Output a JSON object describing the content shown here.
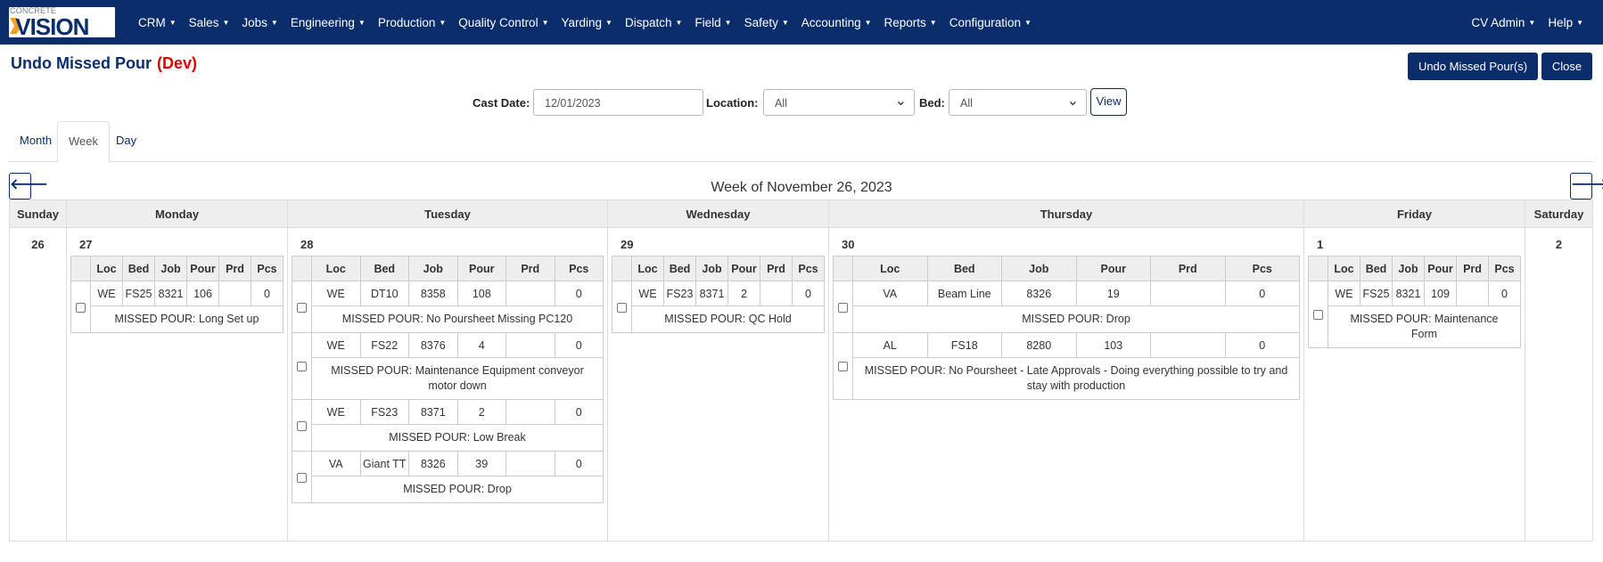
{
  "nav": {
    "logo_small": "CONCRETE",
    "logo_big": "VISION",
    "items": [
      "CRM",
      "Sales",
      "Jobs",
      "Engineering",
      "Production",
      "Quality Control",
      "Yarding",
      "Dispatch",
      "Field",
      "Safety",
      "Accounting",
      "Reports",
      "Configuration"
    ],
    "user": "CV Admin",
    "help": "Help"
  },
  "page": {
    "title": "Undo Missed Pour",
    "env": "(Dev)",
    "undo_button": "Undo Missed Pour(s)",
    "close_button": "Close"
  },
  "filters": {
    "cast_date_label": "Cast Date:",
    "cast_date_value": "12/01/2023",
    "location_label": "Location:",
    "location_value": "All",
    "bed_label": "Bed:",
    "bed_value": "All",
    "view_button": "View"
  },
  "tabs": [
    "Month",
    "Week",
    "Day"
  ],
  "active_tab": "Week",
  "week": {
    "title": "Week of November 26, 2023",
    "prev_icon": "arrow-left-icon",
    "next_icon": "arrow-right-icon"
  },
  "columns": [
    "Loc",
    "Bed",
    "Job",
    "Pour",
    "Prd",
    "Pcs"
  ],
  "days": [
    {
      "name": "Sunday",
      "num": "26",
      "pours": []
    },
    {
      "name": "Monday",
      "num": "27",
      "pours": [
        {
          "loc": "WE",
          "bed": "FS25",
          "job": "8321",
          "pour": "106",
          "prd": "",
          "pcs": "0",
          "msg": "MISSED POUR: Long Set up"
        }
      ]
    },
    {
      "name": "Tuesday",
      "num": "28",
      "pours": [
        {
          "loc": "WE",
          "bed": "DT10",
          "job": "8358",
          "pour": "108",
          "prd": "",
          "pcs": "0",
          "msg": "MISSED POUR: No Poursheet Missing PC120"
        },
        {
          "loc": "WE",
          "bed": "FS22",
          "job": "8376",
          "pour": "4",
          "prd": "",
          "pcs": "0",
          "msg": "MISSED POUR: Maintenance Equipment conveyor motor down"
        },
        {
          "loc": "WE",
          "bed": "FS23",
          "job": "8371",
          "pour": "2",
          "prd": "",
          "pcs": "0",
          "msg": "MISSED POUR: Low Break"
        },
        {
          "loc": "VA",
          "bed": "Giant TT",
          "job": "8326",
          "pour": "39",
          "prd": "",
          "pcs": "0",
          "msg": "MISSED POUR: Drop"
        }
      ]
    },
    {
      "name": "Wednesday",
      "num": "29",
      "pours": [
        {
          "loc": "WE",
          "bed": "FS23",
          "job": "8371",
          "pour": "2",
          "prd": "",
          "pcs": "0",
          "msg": "MISSED POUR: QC Hold"
        }
      ]
    },
    {
      "name": "Thursday",
      "num": "30",
      "pours": [
        {
          "loc": "VA",
          "bed": "Beam Line",
          "job": "8326",
          "pour": "19",
          "prd": "",
          "pcs": "0",
          "msg": "MISSED POUR: Drop"
        },
        {
          "loc": "AL",
          "bed": "FS18",
          "job": "8280",
          "pour": "103",
          "prd": "",
          "pcs": "0",
          "msg": "MISSED POUR: No Poursheet - Late Approvals - Doing everything possible to try and stay with production"
        }
      ]
    },
    {
      "name": "Friday",
      "num": "1",
      "pours": [
        {
          "loc": "WE",
          "bed": "FS25",
          "job": "8321",
          "pour": "109",
          "prd": "",
          "pcs": "0",
          "msg": "MISSED POUR: Maintenance Form"
        }
      ]
    },
    {
      "name": "Saturday",
      "num": "2",
      "pours": []
    }
  ],
  "colors": {
    "navbar": "#0b2d6b",
    "env_tag": "#e00000"
  }
}
